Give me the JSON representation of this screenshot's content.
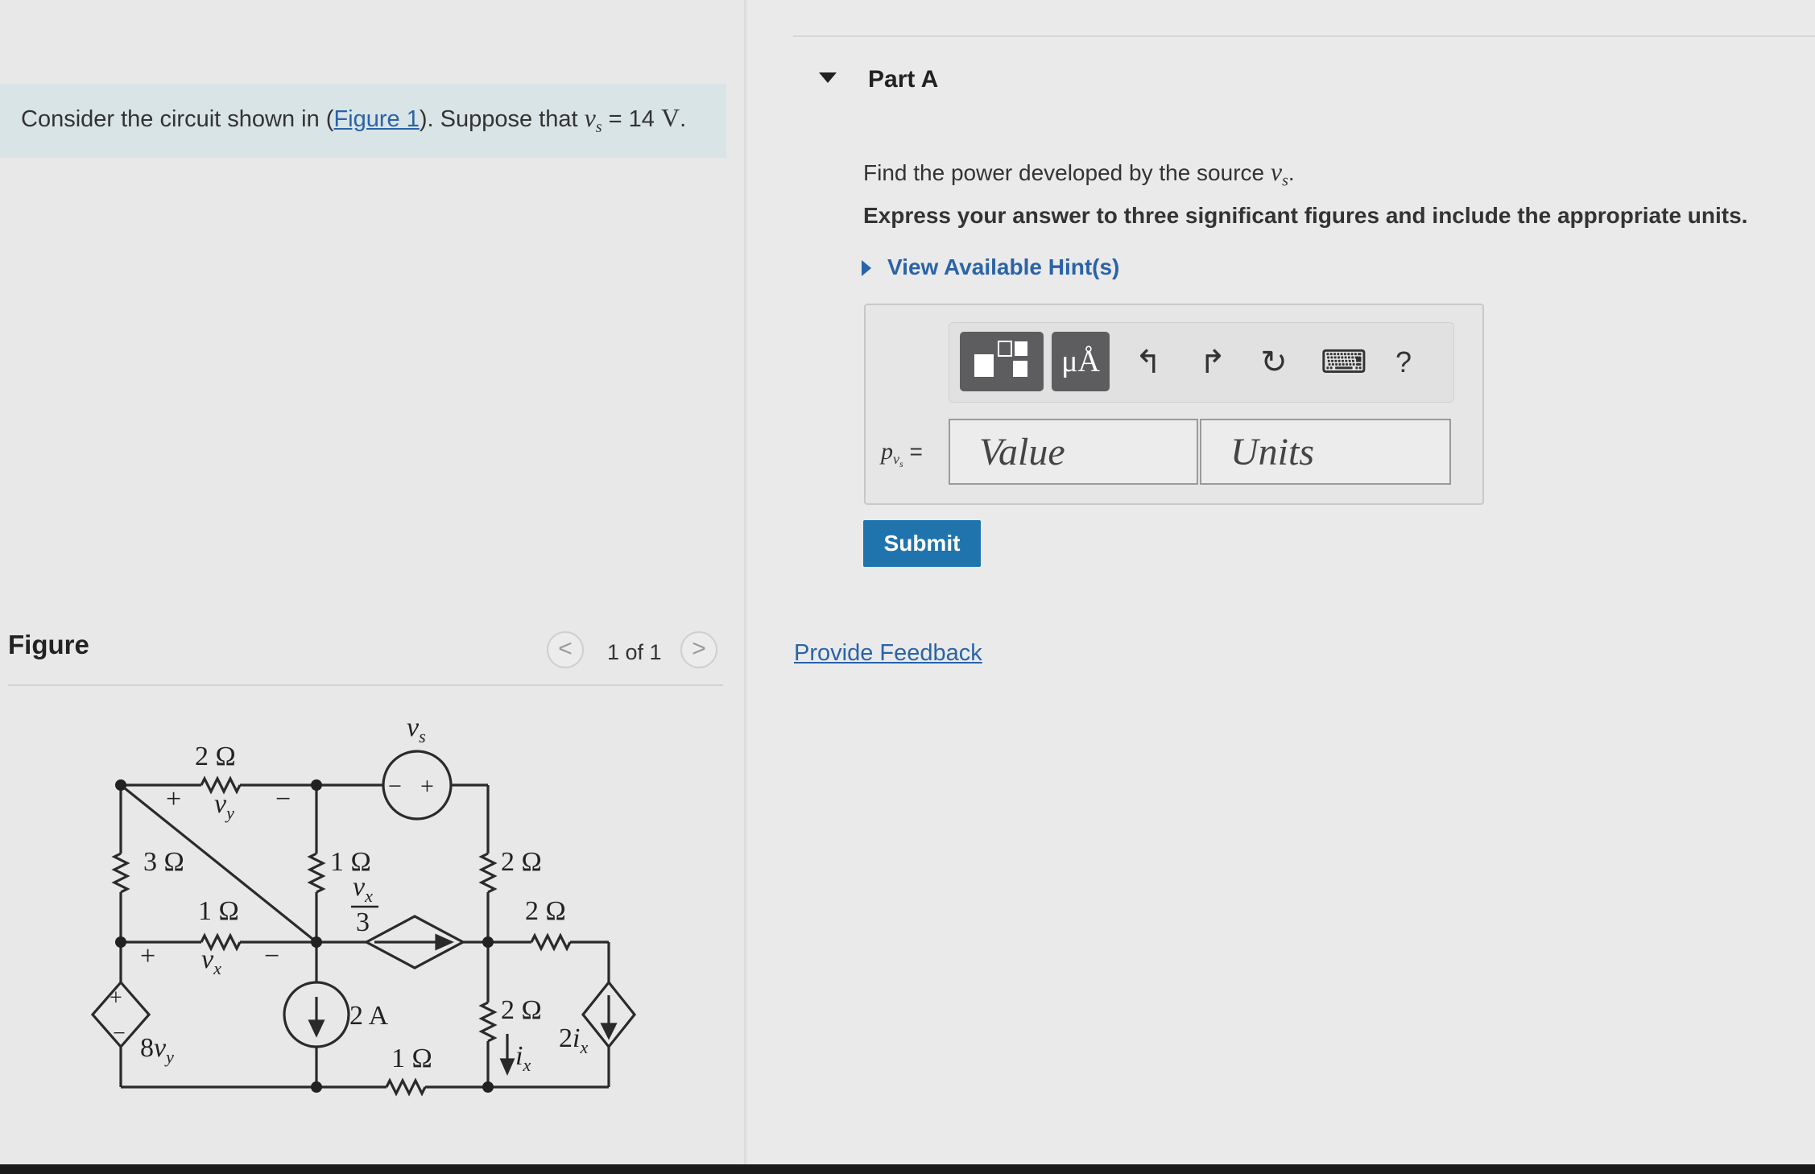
{
  "problem": {
    "prefix": "Consider the circuit shown in (",
    "figure_link": "Figure 1",
    "mid": "). Suppose that ",
    "var": "v",
    "var_sub": "s",
    "value": " = 14 ",
    "unit": "V",
    "end": "."
  },
  "figure": {
    "title": "Figure",
    "counter": "1 of 1",
    "prev_glyph": "<",
    "next_glyph": ">"
  },
  "circuit": {
    "r_top": "2 Ω",
    "r_left": "3 Ω",
    "r_mid_top": "1 Ω",
    "r_mid": "1 Ω",
    "r_right_top": "2 Ω",
    "r_right_mid": "2 Ω",
    "r_right_low": "2 Ω",
    "r_bottom": "1 Ω",
    "vy_label": "v",
    "vy_sub": "y",
    "vx_label": "v",
    "vx_sub": "x",
    "vs_label": "v",
    "vs_sub": "s",
    "plus": "+",
    "minus": "−",
    "dep_v_coef": "8",
    "dep_v_var": "v",
    "dep_v_sub": "y",
    "dep_c_num": "v",
    "dep_c_num_sub": "x",
    "dep_c_den": "3",
    "cs_label": "2 A",
    "ix_label": "i",
    "ix_sub": "x",
    "dep_c2_coef": "2",
    "dep_c2_var": "i",
    "dep_c2_sub": "x"
  },
  "part": {
    "title": "Part A",
    "question_prefix": "Find the power developed by the source ",
    "question_var": "v",
    "question_sub": "s",
    "question_end": ".",
    "instruction": "Express your answer to three significant figures and include the appropriate units.",
    "hint_label": "View Available Hint(s)"
  },
  "toolbar": {
    "units_symbol": "μÅ",
    "undo_icon": "↰",
    "redo_icon": "↱",
    "reset_icon": "↻",
    "keyboard_icon": "⌨",
    "help_label": "?"
  },
  "answer": {
    "label_var": "p",
    "label_sub": "v",
    "label_subsub": "s",
    "label_eq": " =",
    "value_placeholder": "Value",
    "units_placeholder": "Units"
  },
  "submit_label": "Submit",
  "feedback_label": "Provide Feedback"
}
